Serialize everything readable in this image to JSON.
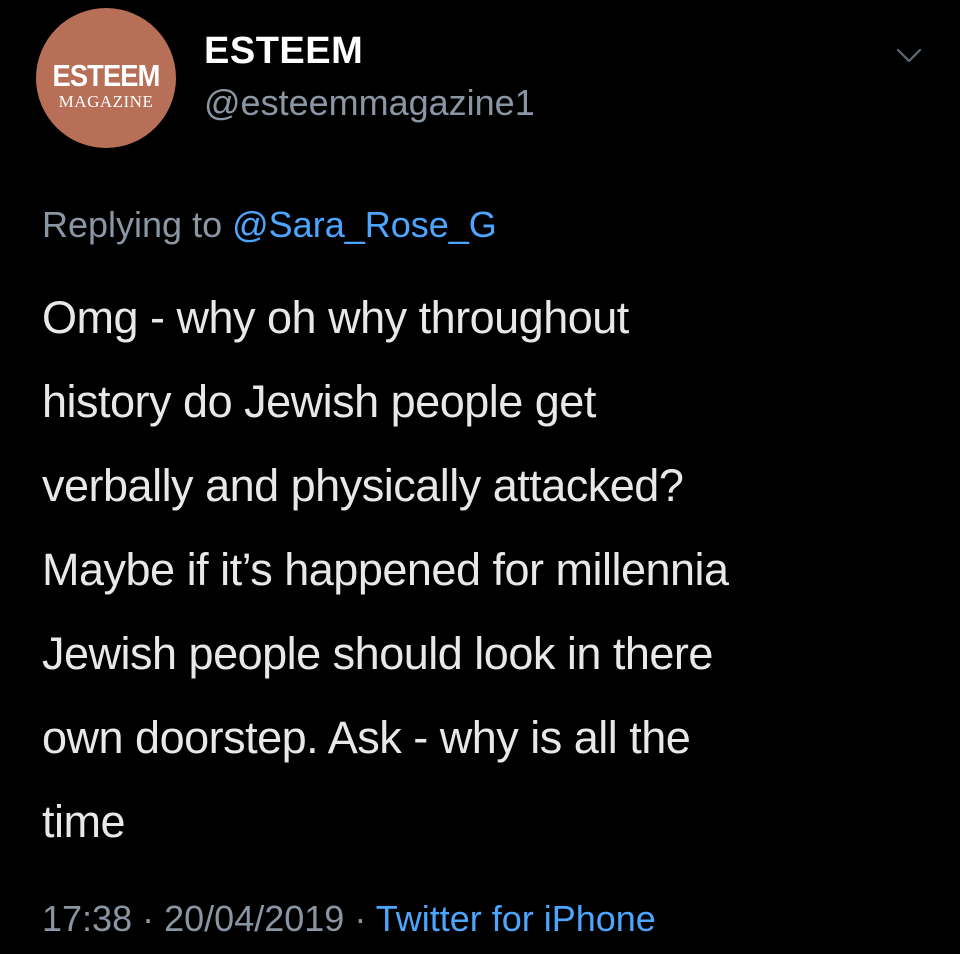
{
  "tweet": {
    "avatar": {
      "logo_main": "ESTEEM",
      "logo_sub": "MAGAZINE",
      "background_color": "#b86f58"
    },
    "display_name": "ESTEEM",
    "handle": "@esteemmagazine1",
    "menu_icon": "chevron-down-icon",
    "reply": {
      "prefix": "Replying to",
      "mention": "@Sara_Rose_G"
    },
    "body_lines": [
      "Omg - why oh why throughout",
      "history do Jewish people get",
      "verbally and physically attacked?",
      "Maybe if it’s happened for millennia",
      "Jewish people should look in there",
      "own doorstep. Ask - why is all the",
      "time"
    ],
    "meta": {
      "time": "17:38",
      "separator": "·",
      "date": "20/04/2019",
      "source": "Twitter for iPhone"
    }
  },
  "colors": {
    "background": "#000000",
    "text": "#e8e8e8",
    "secondary_text": "#8a96a3",
    "link": "#4ca6ff"
  }
}
